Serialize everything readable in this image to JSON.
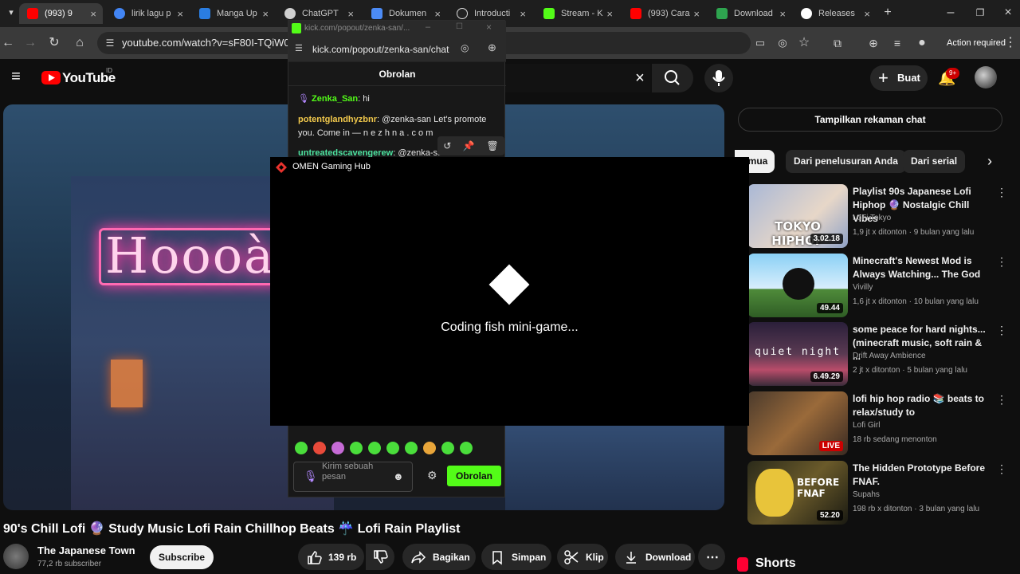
{
  "browser": {
    "tabs": [
      {
        "label": "(993) 9",
        "color": "#ff0000",
        "active": true
      },
      {
        "label": "lirik lagu p",
        "color": "#4285f4"
      },
      {
        "label": "Manga Up",
        "color": "#2a7de1"
      },
      {
        "label": "ChatGPT",
        "color": "#cfcfcf"
      },
      {
        "label": "Dokumen",
        "color": "#4c8bf5"
      },
      {
        "label": "Introducti",
        "color": "#dddddd"
      },
      {
        "label": "Stream - K",
        "color": "#53fc18"
      },
      {
        "label": "(993) Cara",
        "color": "#ff0000"
      },
      {
        "label": "Download",
        "color": "#2ea44f"
      },
      {
        "label": "Releases",
        "color": "#ffffff"
      }
    ],
    "url": "youtube.com/watch?v=sF80I-TQiW0",
    "action_required": "Action required"
  },
  "youtube": {
    "logo_text": "YouTube",
    "logo_region": "ID",
    "create_label": "Buat",
    "notification_count": "9+",
    "video_title": "90's Chill Lofi 🔮 Study Music Lofi Rain Chillhop Beats ☔ Lofi Rain Playlist",
    "channel_name": "The Japanese Town",
    "channel_subs": "77,2 rb subscriber",
    "subscribe_label": "Subscribe",
    "actions": {
      "likes": "139 rb",
      "share": "Bagikan",
      "save": "Simpan",
      "clip": "Klip",
      "download": "Download"
    },
    "video_neon_text": "Hoooàe",
    "replay_chat": "Tampilkan rekaman chat",
    "chips": [
      "emua",
      "Dari penelusuran Anda",
      "Dari serial"
    ],
    "recommendations": [
      {
        "title": "Playlist 90s Japanese Lofi Hiphop 🔮 Nostalgic Chill Vibes",
        "channel": "LoFi Tokyo",
        "meta": "1,9 jt x ditonton · 9 bulan yang lalu",
        "duration": "3.02.18",
        "thumb_text": "TOKYO HIPHOP"
      },
      {
        "title": "Minecraft's Newest Mod is Always Watching... The God",
        "channel": "Vivilly",
        "meta": "1,6 jt x ditonton · 10 bulan yang lalu",
        "duration": "49.44",
        "thumb_text": ""
      },
      {
        "title": "some peace for hard nights... (minecraft music, soft rain & ...",
        "channel": "Drift Away Ambience",
        "meta": "2 jt x ditonton · 5 bulan yang lalu",
        "duration": "6.49.29",
        "thumb_text": "quiet night"
      },
      {
        "title": "lofi hip hop radio 📚 beats to relax/study to",
        "channel": "Lofi Girl",
        "meta": "18 rb sedang menonton",
        "duration": "LIVE",
        "thumb_text": ""
      },
      {
        "title": "The Hidden Prototype Before FNAF.",
        "channel": "Supahs",
        "meta": "198 rb x ditonton · 3 bulan yang lalu",
        "duration": "52.20",
        "thumb_text": "BEFORE FNAF"
      }
    ],
    "shorts_label": "Shorts"
  },
  "kick": {
    "window_title": "kick.com/popout/zenka-san/...",
    "url": "kick.com/popout/zenka-san/chat",
    "header": "Obrolan",
    "messages": [
      {
        "user": "Zenka_San",
        "text": " hi",
        "user_color": "#53fc18"
      },
      {
        "user": "potentglandhyzbnr",
        "text": " @zenka-san Let's promote  you. Come in — n e z h n a . c o m",
        "user_color": "#f2c94c"
      },
      {
        "user": "untreatedscavengerew",
        "text": " @zenka-san Let's",
        "user_color": "#4de3a0"
      }
    ],
    "input_placeholder": "Kirim sebuah pesan",
    "send_label": "Obrolan"
  },
  "omen": {
    "title": "OMEN Gaming Hub",
    "status": "Coding fish mini-game..."
  }
}
